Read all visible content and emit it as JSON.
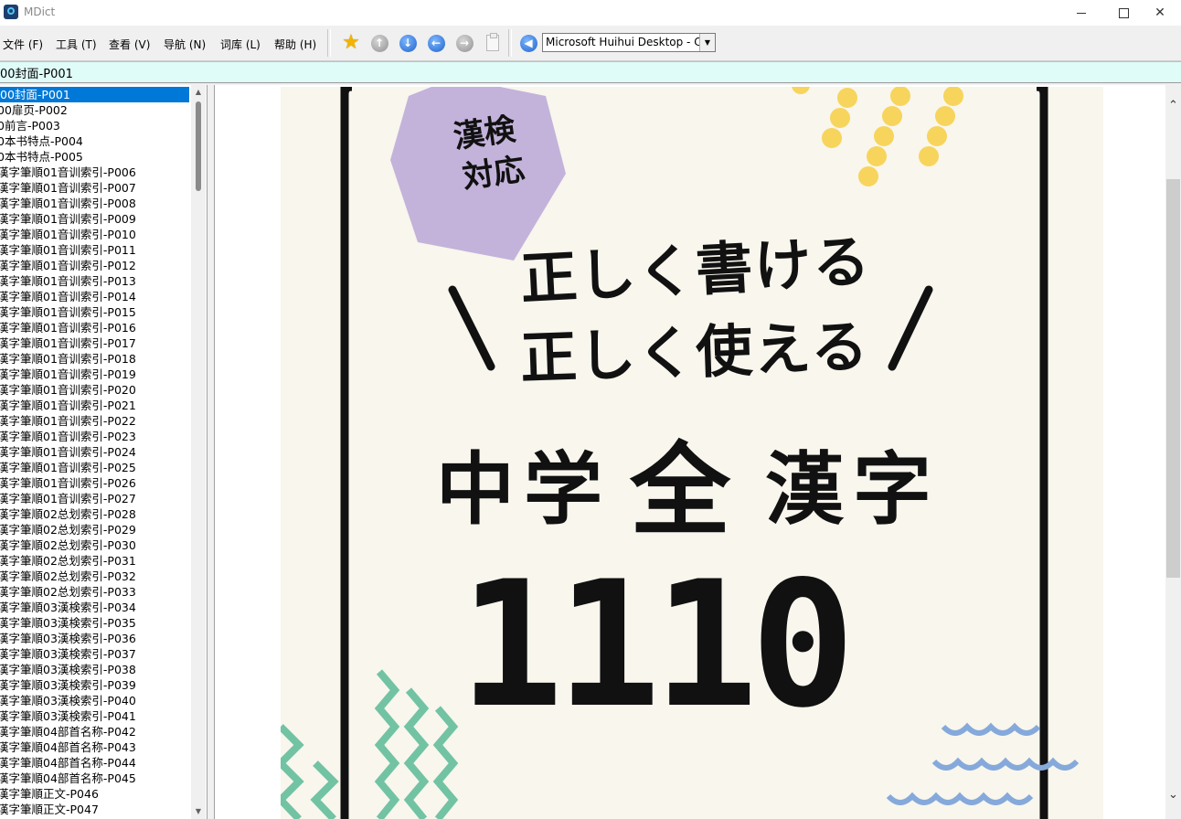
{
  "window": {
    "title": "MDict"
  },
  "menu": [
    "文件 (F)",
    "工具 (T)",
    "查看 (V)",
    "导航 (N)",
    "词库 (L)",
    "帮助 (H)"
  ],
  "toolbar": {
    "icons": [
      "star-icon",
      "up-arrow-icon",
      "down-arrow-icon",
      "back-arrow-icon",
      "forward-arrow-icon",
      "clipboard-icon",
      "speaker-icon"
    ],
    "font_select": "Microsoft Huihui Desktop - C"
  },
  "search": {
    "value": "00封面-P001"
  },
  "entries": [
    "00封面-P001",
    "00扉页-P002",
    "0前言-P003",
    "0本书特点-P004",
    "0本书特点-P005",
    "漢字筆順01音训索引-P006",
    "漢字筆順01音训索引-P007",
    "漢字筆順01音训索引-P008",
    "漢字筆順01音训索引-P009",
    "漢字筆順01音训索引-P010",
    "漢字筆順01音训索引-P011",
    "漢字筆順01音训索引-P012",
    "漢字筆順01音训索引-P013",
    "漢字筆順01音训索引-P014",
    "漢字筆順01音训索引-P015",
    "漢字筆順01音训索引-P016",
    "漢字筆順01音训索引-P017",
    "漢字筆順01音训索引-P018",
    "漢字筆順01音训索引-P019",
    "漢字筆順01音训索引-P020",
    "漢字筆順01音训索引-P021",
    "漢字筆順01音训索引-P022",
    "漢字筆順01音训索引-P023",
    "漢字筆順01音训索引-P024",
    "漢字筆順01音训索引-P025",
    "漢字筆順01音训索引-P026",
    "漢字筆順01音训索引-P027",
    "漢字筆順02总划索引-P028",
    "漢字筆順02总划索引-P029",
    "漢字筆順02总划索引-P030",
    "漢字筆順02总划索引-P031",
    "漢字筆順02总划索引-P032",
    "漢字筆順02总划索引-P033",
    "漢字筆順03漢検索引-P034",
    "漢字筆順03漢検索引-P035",
    "漢字筆順03漢検索引-P036",
    "漢字筆順03漢検索引-P037",
    "漢字筆順03漢検索引-P038",
    "漢字筆順03漢検索引-P039",
    "漢字筆順03漢検索引-P040",
    "漢字筆順03漢検索引-P041",
    "漢字筆順04部首名称-P042",
    "漢字筆順04部首名称-P043",
    "漢字筆順04部首名称-P044",
    "漢字筆順04部首名称-P045",
    "漢字筆順正文-P046",
    "漢字筆順正文-P047"
  ],
  "cover": {
    "badge_line1": "漢検",
    "badge_line2": "対応",
    "tagline1": "正しく書ける",
    "tagline2": "正しく使える",
    "title_a": "中学",
    "title_b": "全",
    "title_c": "漢字",
    "number": "1110",
    "colors": {
      "badge": "#c3b3db",
      "dots": "#f7d45c",
      "zigzag": "#72c3a3",
      "waves": "#86a9db",
      "frame": "#111111"
    }
  }
}
